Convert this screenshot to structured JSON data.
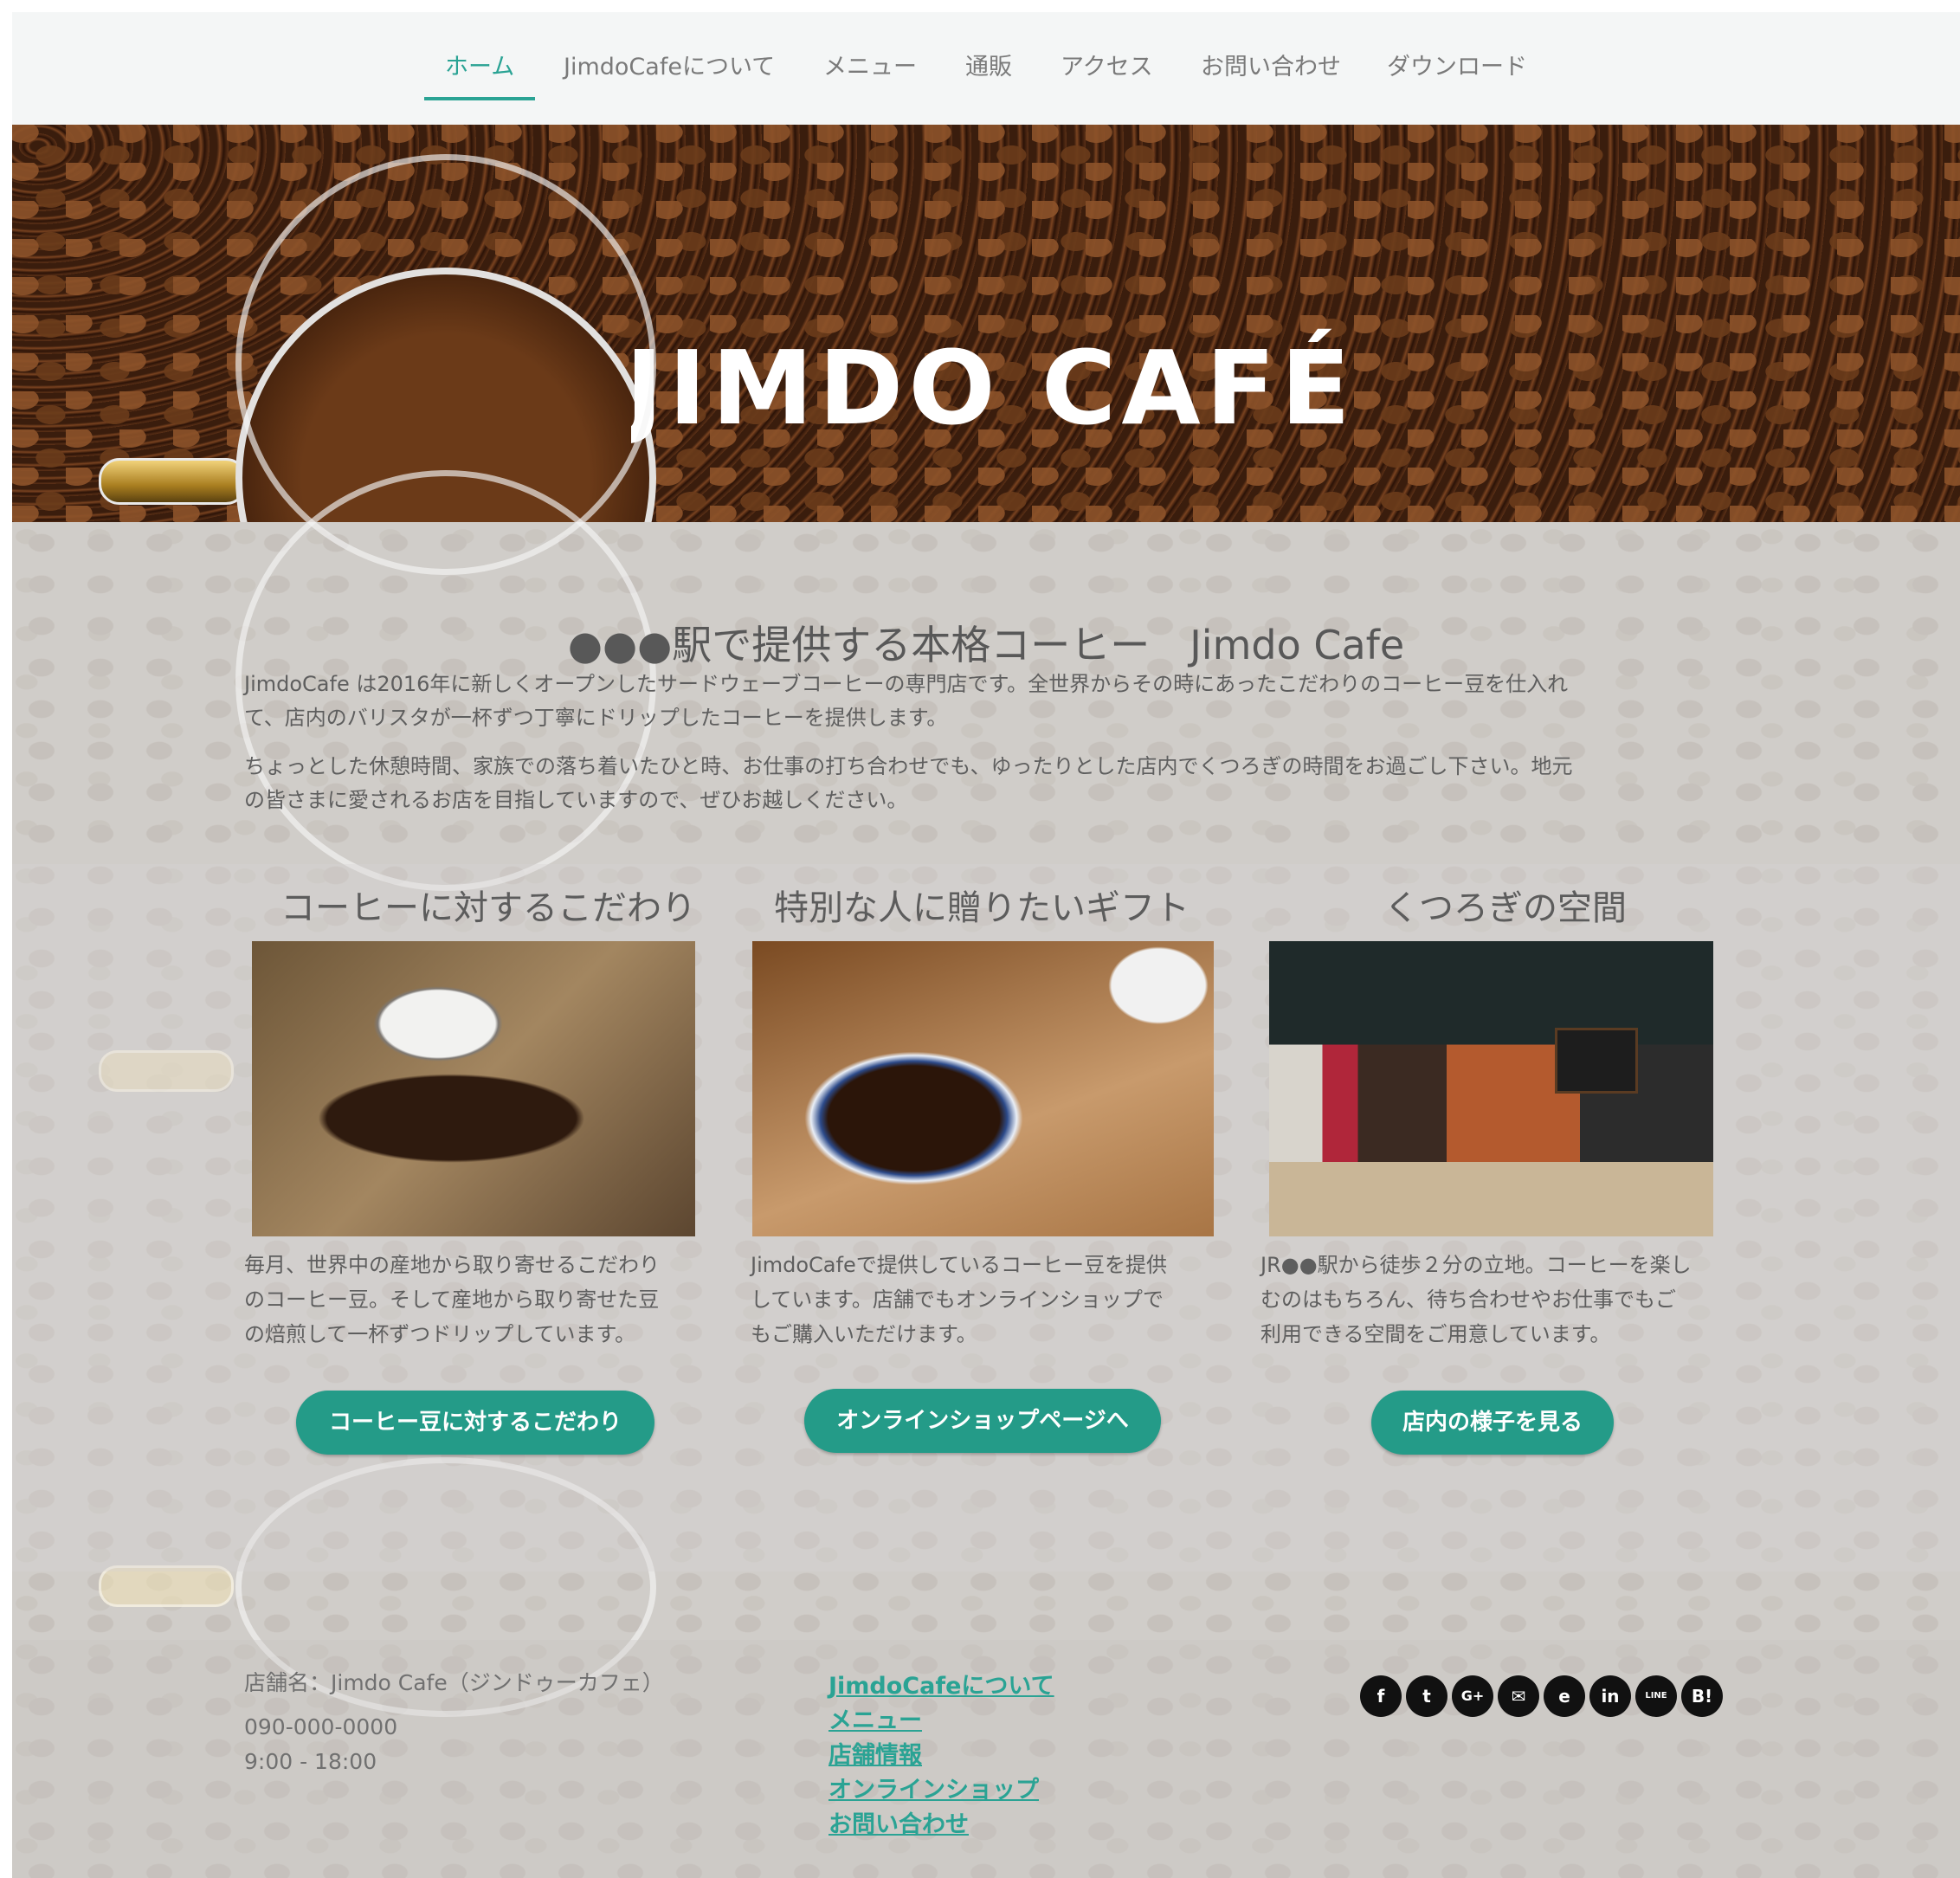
{
  "nav": {
    "items": [
      {
        "label": "ホーム",
        "active": true
      },
      {
        "label": "JimdoCafeについて"
      },
      {
        "label": "メニュー"
      },
      {
        "label": "通販"
      },
      {
        "label": "アクセス"
      },
      {
        "label": "お問い合わせ"
      },
      {
        "label": "ダウンロード"
      }
    ]
  },
  "header": {
    "logo_text": "JIMDO CAFÉ"
  },
  "intro": {
    "title": "●●●駅で提供する本格コーヒー　Jimdo Cafe",
    "para1_line1": "JimdoCafe は2016年に新しくオープンしたサードウェーブコーヒーの専門店です。全世界からその時にあったこだわりのコーヒー豆を仕入れ",
    "para1_line2": "て、店内のバリスタが一杯ずつ丁寧にドリップしたコーヒーを提供します。",
    "para2_line1": " ちょっとした休憩時間、家族での落ち着いたひと時、お仕事の打ち合わせでも、ゆったりとした店内でくつろぎの時間をお過ごし下さい。地元",
    "para2_line2": "の皆さまに愛されるお店を目指していますので、ぜひお越しください。"
  },
  "columns": [
    {
      "title": "コーヒーに対するこだわり",
      "lines": [
        "毎月、世界中の産地から取り寄せるこだわり",
        "のコーヒー豆。そして産地から取り寄せた豆",
        "の焙煎して一杯ずつドリップしています。"
      ],
      "button": "コーヒー豆に対するこだわり"
    },
    {
      "title": "特別な人に贈りたいギフト",
      "lines": [
        "JimdoCafeで提供しているコーヒー豆を提供",
        "しています。店舗でもオンラインショップで",
        "もご購入いただけます。"
      ],
      "button": "オンラインショップページへ"
    },
    {
      "title": "くつろぎの空間",
      "lines": [
        "JR●●駅から徒歩２分の立地。コーヒーを楽し",
        "むのはもちろん、待ち合わせやお仕事でもご",
        "利用できる空間をご用意しています。"
      ],
      "button": "店内の様子を見る"
    }
  ],
  "footer": {
    "shop_name": "店舗名：Jimdo Cafe（ジンドゥーカフェ）",
    "phone": "090-000-0000",
    "hours": "9:00 - 18:00",
    "links": [
      "JimdoCafeについて",
      "メニュー",
      "店舗情報",
      "オンラインショップ",
      "お問い合わせ"
    ],
    "social_icons": [
      {
        "name": "facebook-icon",
        "glyph": "f"
      },
      {
        "name": "twitter-icon",
        "glyph": "t"
      },
      {
        "name": "google-plus-icon",
        "glyph": "G+"
      },
      {
        "name": "mail-icon",
        "glyph": "✉"
      },
      {
        "name": "evernote-icon",
        "glyph": "e"
      },
      {
        "name": "linkedin-icon",
        "glyph": "in"
      },
      {
        "name": "line-icon",
        "glyph": "LINE"
      },
      {
        "name": "hatena-bookmark-icon",
        "glyph": "B!"
      }
    ]
  },
  "colors": {
    "accent": "#2aa394",
    "button": "#249b88",
    "nav_bg": "#f4f6f6",
    "text": "#5e5e5e"
  }
}
